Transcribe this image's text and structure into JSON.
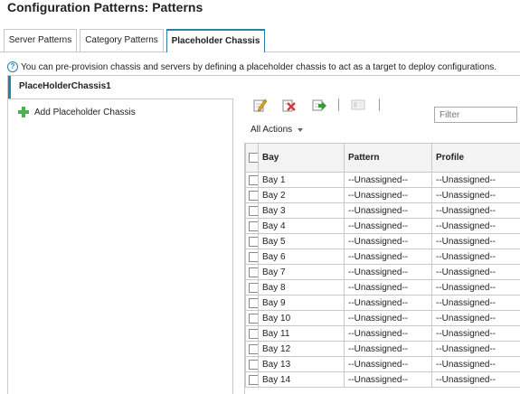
{
  "page": {
    "title": "Configuration Patterns: Patterns"
  },
  "tabs": [
    {
      "label": "Server Patterns"
    },
    {
      "label": "Category Patterns"
    },
    {
      "label": "Placeholder Chassis",
      "active": true
    }
  ],
  "info": {
    "icon": "help-circle-icon",
    "text": "You can pre-provision chassis and servers by defining a placeholder chassis to act as a target to deploy configurations."
  },
  "chassis_list": {
    "selected": "PlaceHolderChassis1",
    "add_label": "Add Placeholder Chassis"
  },
  "toolbar": {
    "icons": [
      "edit-icon",
      "delete-icon",
      "deploy-icon",
      "unassign-icon"
    ],
    "filter_placeholder": "Filter",
    "all_actions_label": "All Actions"
  },
  "table": {
    "columns": [
      "Bay",
      "Pattern",
      "Profile"
    ],
    "rows": [
      [
        "Bay 1",
        "--Unassigned--",
        "--Unassigned--"
      ],
      [
        "Bay 2",
        "--Unassigned--",
        "--Unassigned--"
      ],
      [
        "Bay 3",
        "--Unassigned--",
        "--Unassigned--"
      ],
      [
        "Bay 4",
        "--Unassigned--",
        "--Unassigned--"
      ],
      [
        "Bay 5",
        "--Unassigned--",
        "--Unassigned--"
      ],
      [
        "Bay 6",
        "--Unassigned--",
        "--Unassigned--"
      ],
      [
        "Bay 7",
        "--Unassigned--",
        "--Unassigned--"
      ],
      [
        "Bay 8",
        "--Unassigned--",
        "--Unassigned--"
      ],
      [
        "Bay 9",
        "--Unassigned--",
        "--Unassigned--"
      ],
      [
        "Bay 10",
        "--Unassigned--",
        "--Unassigned--"
      ],
      [
        "Bay 11",
        "--Unassigned--",
        "--Unassigned--"
      ],
      [
        "Bay 12",
        "--Unassigned--",
        "--Unassigned--"
      ],
      [
        "Bay 13",
        "--Unassigned--",
        "--Unassigned--"
      ],
      [
        "Bay 14",
        "--Unassigned--",
        "--Unassigned--"
      ]
    ]
  },
  "colors": {
    "accent": "#2a7fa8",
    "border": "#c8c8c8",
    "add_green": "#4caf50",
    "delete_red": "#d23b3b"
  }
}
